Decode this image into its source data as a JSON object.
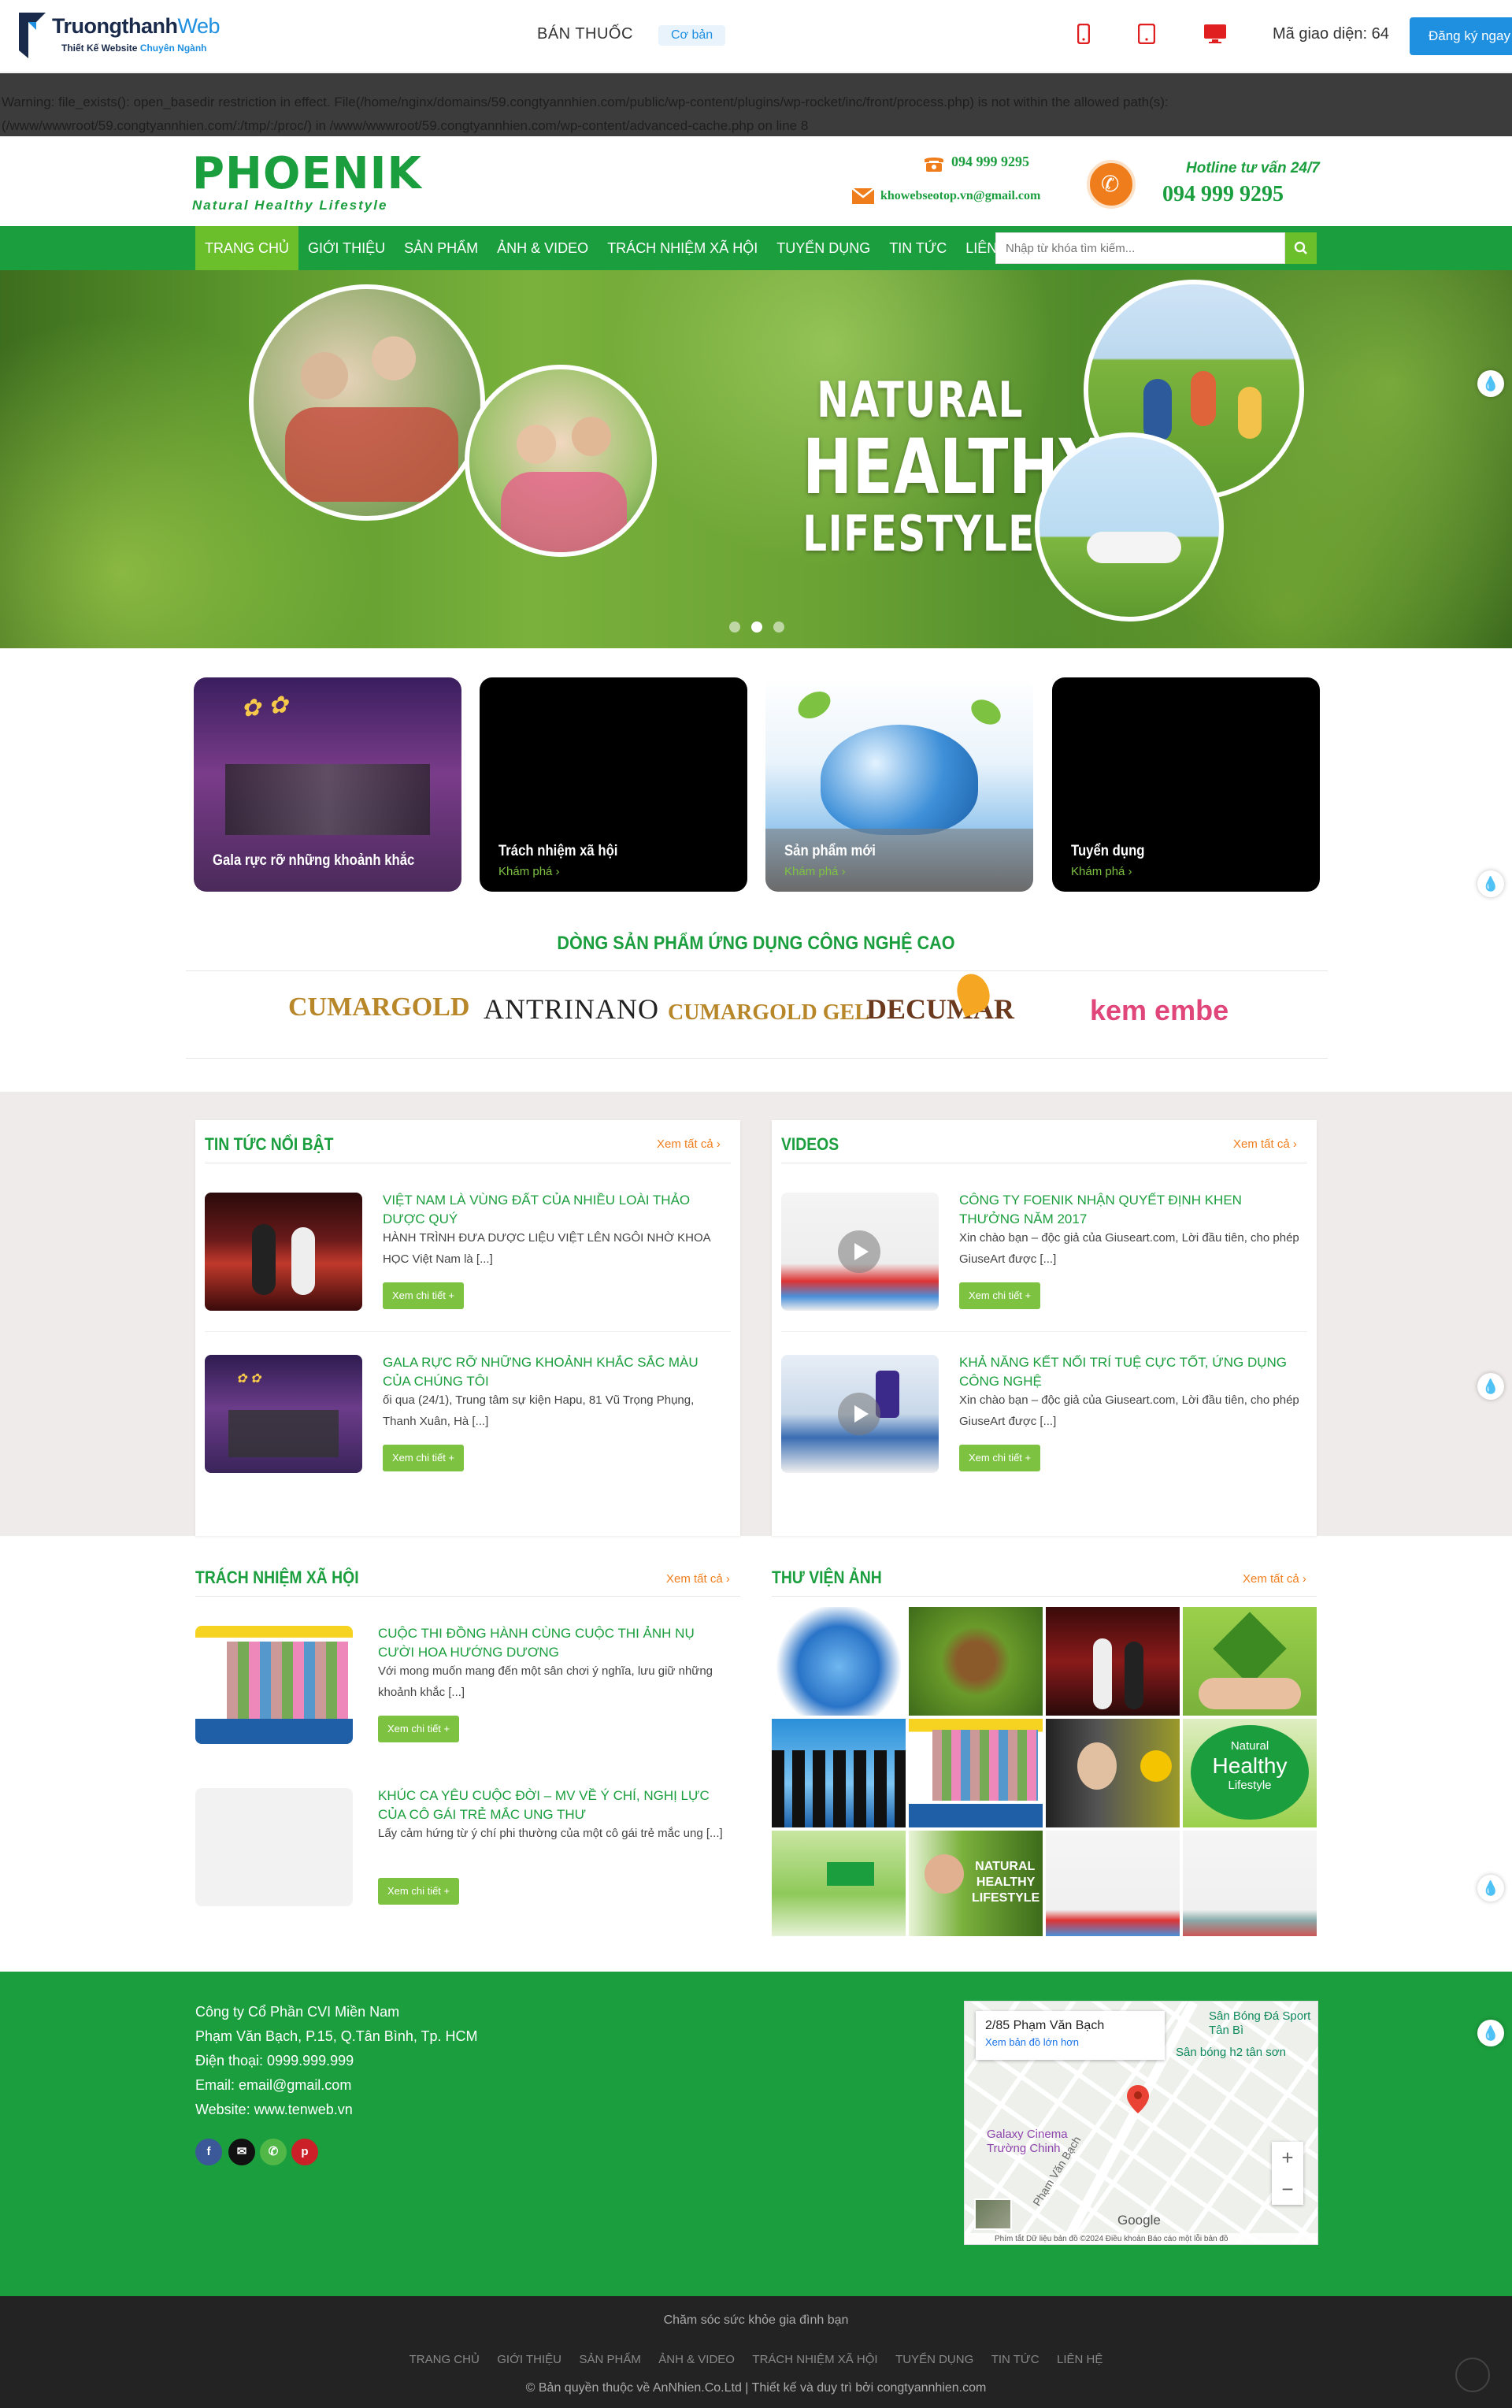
{
  "topbar": {
    "logo_brand": "Truongthanh",
    "logo_web": "Web",
    "logo_sub": "Thiết Kế Website",
    "logo_sub_accent": "Chuyên Ngành",
    "theme_name": "BÁN THUỐC",
    "theme_badge": "Cơ bản",
    "theme_code": "Mã giao diện: 64",
    "register": "Đăng ký ngay"
  },
  "warning": {
    "line1": "Warning: file_exists(): open_basedir restriction in effect. File(/home/nginx/domains/59.congtyannhien.com/public/wp-content/plugins/wp-rocket/inc/front/process.php) is not within the allowed path(s):",
    "line2": "(/www/wwwroot/59.congtyannhien.com/:/tmp/:/proc/) in /www/wwwroot/59.congtyannhien.com/wp-content/advanced-cache.php on line 8"
  },
  "header": {
    "logo_title": "PHOENIK",
    "logo_sub": "Natural Healthy Lifestyle",
    "phone": "094 999 9295",
    "email": "khowebseotop.vn@gmail.com",
    "hotline_label": "Hotline tư vấn 24/7",
    "hotline_number": "094 999 9295"
  },
  "nav": {
    "items": [
      {
        "label": "TRANG CHỦ"
      },
      {
        "label": "GIỚI THIỆU"
      },
      {
        "label": "SẢN PHẨM"
      },
      {
        "label": "ẢNH & VIDEO"
      },
      {
        "label": "TRÁCH NHIỆM XÃ HỘI"
      },
      {
        "label": "TUYỂN DỤNG"
      },
      {
        "label": "TIN TỨC"
      },
      {
        "label": "LIÊN HỆ"
      }
    ],
    "search_placeholder": "Nhập từ khóa tìm kiếm..."
  },
  "hero": {
    "line1": "NATURAL",
    "line2": "HEALTHY",
    "line3": "LIFESTYLE",
    "slide_count": 3,
    "active_slide": 2
  },
  "features": [
    {
      "title": "Gala rực rỡ những khoảnh khắc",
      "link": ""
    },
    {
      "title": "Trách nhiệm xã hội",
      "link": "Khám phá ›"
    },
    {
      "title": "Sản phẩm mới",
      "link": "Khám phá ›"
    },
    {
      "title": "Tuyển dụng",
      "link": "Khám phá ›"
    }
  ],
  "product_lines": {
    "title": "DÒNG SẢN PHẨM ỨNG DỤNG CÔNG NGHỆ CAO",
    "brands": [
      "CUMARGOLD",
      "ANTRINANO",
      "CUMARGOLD GEL",
      "DECUMAR",
      "kem embe"
    ]
  },
  "news": {
    "title": "TIN TỨC NỔI BẬT",
    "more": "Xem tất cả ›",
    "posts": [
      {
        "title": "VIỆT NAM LÀ VÙNG ĐẤT CỦA NHIỀU LOÀI THẢO DƯỢC QUÝ",
        "excerpt": "HÀNH TRÌNH ĐƯA DƯỢC LIỆU VIỆT LÊN NGÔI NHỜ KHOA HỌC   Việt Nam là [...]",
        "button": "Xem chi tiết +"
      },
      {
        "title": "GALA RỰC RỠ NHỮNG KHOẢNH KHẮC SẮC MÀU CỦA CHÚNG TÔI",
        "excerpt": "ối qua (24/1), Trung tâm sự kiện Hapu, 81 Vũ Trọng Phụng, Thanh Xuân, Hà [...]",
        "button": "Xem chi tiết +"
      }
    ]
  },
  "videos": {
    "title": "VIDEOS",
    "more": "Xem tất cả ›",
    "posts": [
      {
        "title": "CÔNG TY FOENIK NHẬN QUYẾT ĐỊNH KHEN THƯỞNG NĂM 2017",
        "excerpt": "Xin chào bạn – độc giả của Giuseart.com, Lời đầu tiên, cho phép GiuseArt được [...]",
        "button": "Xem chi tiết +"
      },
      {
        "title": "KHẢ NĂNG KẾT NỐI TRÍ TUỆ CỰC TỐT, ỨNG DỤNG CÔNG NGHỆ",
        "excerpt": "Xin chào bạn – độc giả của Giuseart.com, Lời đầu tiên, cho phép GiuseArt được [...]",
        "button": "Xem chi tiết +"
      }
    ]
  },
  "social": {
    "title": "TRÁCH NHIỆM XÃ HỘI",
    "more": "Xem tất cả ›",
    "posts": [
      {
        "title": "CUỘC THI ĐỒNG HÀNH CÙNG CUỘC THI ẢNH NỤ CƯỜI HOA HƯỚNG DƯƠNG",
        "excerpt": "Với mong muốn mang đến một sân chơi ý nghĩa, lưu giữ những khoảnh khắc [...]",
        "button": "Xem chi tiết +"
      },
      {
        "title": "KHÚC CA YÊU CUỘC ĐỜI – MV VỀ Ý CHÍ, NGHỊ LỰC CỦA CÔ GÁI TRẺ MẮC UNG THƯ",
        "excerpt": "Lấy cảm hứng từ ý chí phi thường của một cô gái trẻ mắc ung [...]",
        "button": "Xem chi tiết +"
      }
    ]
  },
  "gallery": {
    "title": "THƯ VIỆN ẢNH",
    "more": "Xem tất cả ›",
    "tile_healthy_1": "Natural",
    "tile_healthy_2": "Healthy",
    "tile_healthy_3": "Lifestyle"
  },
  "footer": {
    "company": "Công ty Cổ Phần CVI Miền Nam",
    "address": "Phạm Văn Bạch, P.15, Q.Tân Bình, Tp. HCM",
    "phone": "Điện thoại: 0999.999.999",
    "email": "Email: email@gmail.com",
    "website": "Website: www.tenweb.vn"
  },
  "map": {
    "place": "2/85 Phạm Văn Bạch",
    "bigger": "Xem bản đồ lớn hơn",
    "poi1": "Sân Bóng Đá Sport Tân Bì",
    "poi2": "Sân bóng h2 tân sơn",
    "poi3": "Galaxy Cinema Trường Chinh",
    "street": "Phạm Văn Bạch",
    "google": "Google",
    "attrib": "Phím tắt  Dữ liệu bản đồ ©2024  Điều khoản  Báo cáo một lỗi bản đồ"
  },
  "bottom": {
    "slogan": "Chăm sóc sức khỏe gia đình bạn",
    "menu": [
      "TRANG CHỦ",
      "GIỚI THIỆU",
      "SẢN PHẨM",
      "ẢNH & VIDEO",
      "TRÁCH NHIỆM XÃ HỘI",
      "TUYỂN DỤNG",
      "TIN TỨC",
      "LIÊN HỆ"
    ],
    "copyright": "© Bản quyền thuộc về AnNhien.Co.Ltd  |  Thiết kế và duy trì bởi congtyannhien.com"
  },
  "colors": {
    "primary": "#1b9e3e",
    "accent": "#7ec242",
    "orange": "#f07d1c",
    "blue": "#1f8fe0"
  }
}
